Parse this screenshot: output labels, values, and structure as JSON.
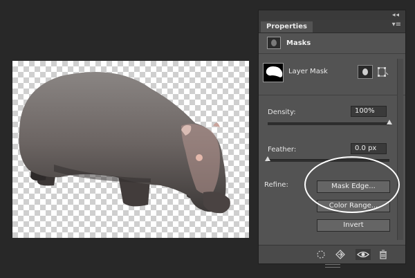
{
  "panel": {
    "collapse_glyph": "◂◂",
    "tab_label": "Properties",
    "tab_menu_glyph": "▾≡",
    "section_title": "Masks",
    "layer_label": "Layer Mask",
    "density": {
      "label": "Density:",
      "value": "100%",
      "level": 1.0
    },
    "feather": {
      "label": "Feather:",
      "value": "0.0 px",
      "level": 0.0
    },
    "refine_label": "Refine:",
    "buttons": {
      "mask_edge": "Mask Edge...",
      "color_range": "Color Range...",
      "invert": "Invert"
    },
    "bottom_icons": [
      "load-selection-icon",
      "apply-mask-icon",
      "visibility-eye-icon",
      "trash-icon"
    ]
  },
  "canvas": {
    "background": "transparency-checkerboard",
    "subject": "hippopotamus"
  },
  "highlight_color": "#ffffff"
}
